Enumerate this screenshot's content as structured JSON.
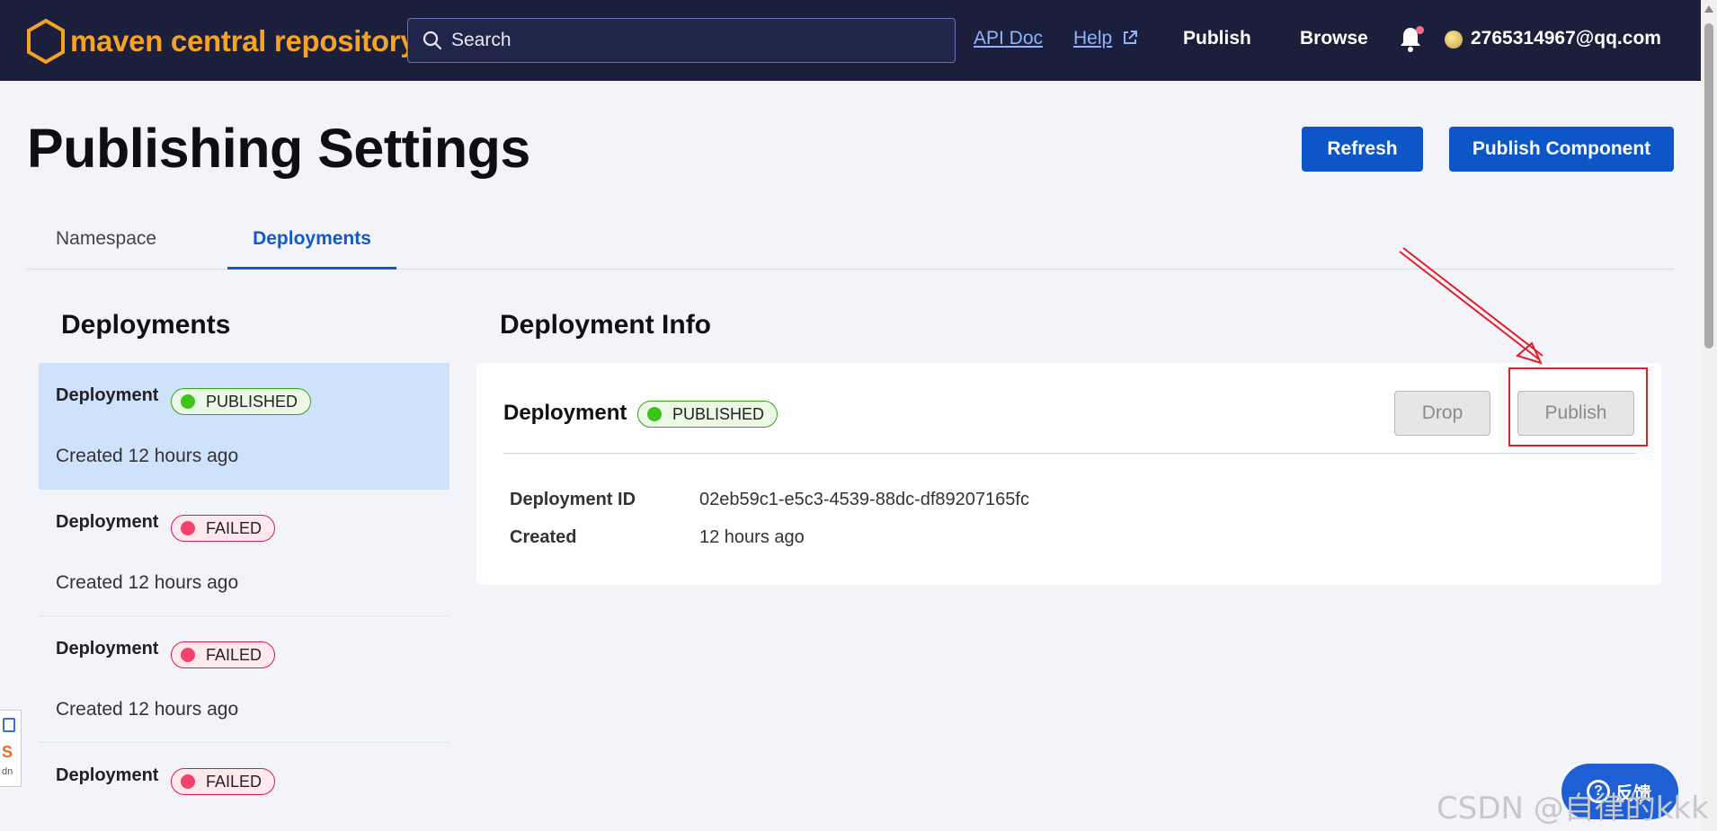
{
  "nav": {
    "logo_text": "maven central repository",
    "search_placeholder": "Search",
    "api_doc": "API Doc",
    "help": "Help",
    "publish": "Publish",
    "browse": "Browse",
    "user_email": "2765314967@qq.com"
  },
  "header": {
    "title": "Publishing Settings",
    "refresh_label": "Refresh",
    "publish_component_label": "Publish Component"
  },
  "tabs": [
    {
      "label": "Namespace",
      "active": false
    },
    {
      "label": "Deployments",
      "active": true
    }
  ],
  "deployments": {
    "title": "Deployments",
    "items": [
      {
        "name": "Deployment",
        "status": "PUBLISHED",
        "created": "Created 12 hours ago",
        "selected": true
      },
      {
        "name": "Deployment",
        "status": "FAILED",
        "created": "Created 12 hours ago",
        "selected": false
      },
      {
        "name": "Deployment",
        "status": "FAILED",
        "created": "Created 12 hours ago",
        "selected": false
      },
      {
        "name": "Deployment",
        "status": "FAILED",
        "created": "",
        "selected": false
      }
    ]
  },
  "info": {
    "title": "Deployment Info",
    "card_name": "Deployment",
    "card_status": "PUBLISHED",
    "drop_label": "Drop",
    "publish_label": "Publish",
    "fields": [
      {
        "label": "Deployment ID",
        "value": "02eb59c1-e5c3-4539-88dc-df89207165fc"
      },
      {
        "label": "Created",
        "value": "12 hours ago"
      }
    ]
  },
  "feedback_label": "反馈",
  "watermark": "CSDN @自律的kkk",
  "colors": {
    "nav_bg": "#1b1f3b",
    "logo": "#f5a324",
    "primary": "#0d56c8",
    "success": "#3cc41a",
    "danger": "#f2426b",
    "annotation": "#e0202a"
  }
}
